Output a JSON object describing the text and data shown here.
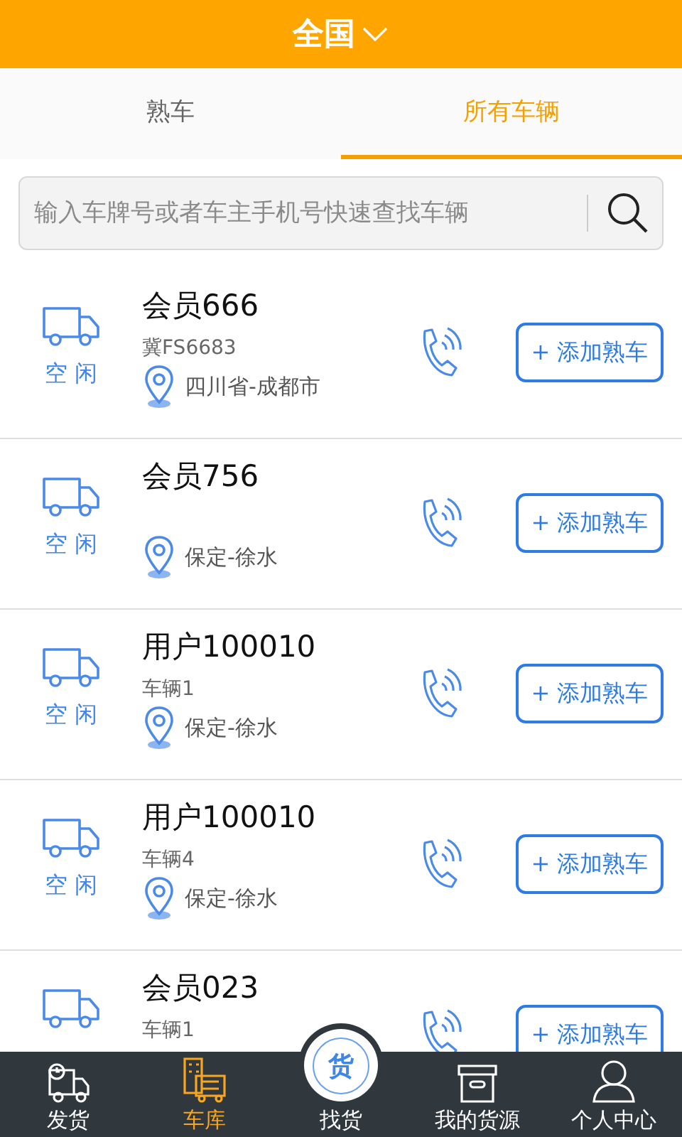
{
  "header": {
    "title": "全国"
  },
  "tabs": [
    {
      "label": "熟车",
      "selected": false
    },
    {
      "label": "所有车辆",
      "selected": true
    }
  ],
  "search": {
    "placeholder": "输入车牌号或者车主手机号快速查找车辆"
  },
  "vehicles": [
    {
      "name": "会员666",
      "status": "空 闲",
      "plate": "冀FS6683",
      "location": "四川省-成都市",
      "action": "+ 添加熟车"
    },
    {
      "name": "会员756",
      "status": "空 闲",
      "location": "保定-徐水",
      "action": "+ 添加熟车"
    },
    {
      "name": "用户100010",
      "status": "空 闲",
      "plate": "车辆1",
      "location": "保定-徐水",
      "action": "+ 添加熟车"
    },
    {
      "name": "用户100010",
      "status": "空 闲",
      "plate": "车辆4",
      "location": "保定-徐水",
      "action": "+ 添加熟车"
    },
    {
      "name": "会员023",
      "plate": "车辆1",
      "action": "+ 添加熟车"
    }
  ],
  "nav": [
    {
      "kind": "ship",
      "label": "发货",
      "selected": false
    },
    {
      "kind": "garage",
      "label": "车库",
      "selected": true
    },
    {
      "kind": "center",
      "label": "找货",
      "badge": "货",
      "selected": false
    },
    {
      "kind": "box",
      "label": "我的货源",
      "selected": false
    },
    {
      "kind": "user",
      "label": "个人中心",
      "selected": false
    }
  ]
}
